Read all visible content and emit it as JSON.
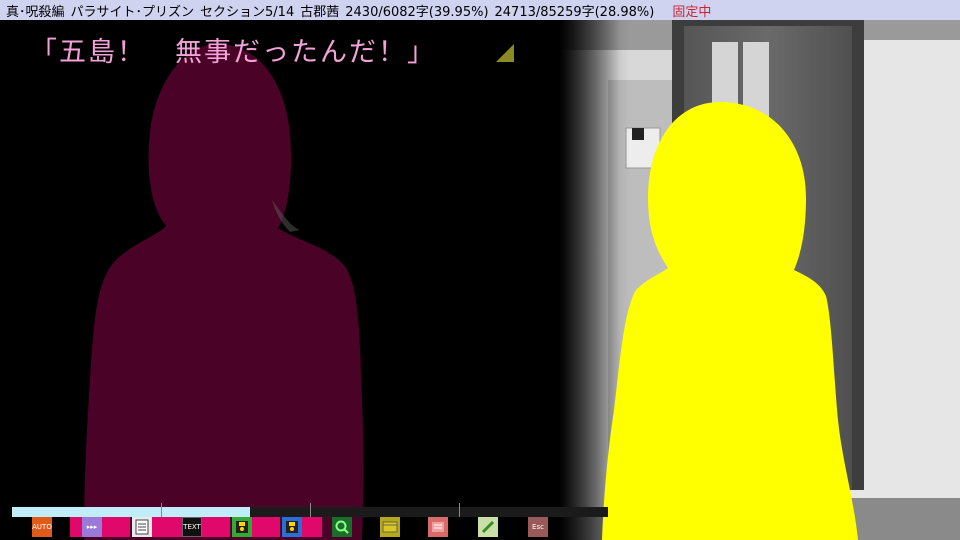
{
  "title_bar": {
    "chapter": "真･呪殺編",
    "location": "パラサイト･プリズン",
    "section": "セクション5/14",
    "character": "古郡茜",
    "section_progress": "2430/6082字(39.95%)",
    "total_progress": "24713/85259字(28.98%)",
    "fixed_status": "固定中"
  },
  "dialogue": {
    "text": "「五島！　無事だったんだ！」"
  },
  "progress": {
    "fraction": 0.3995
  },
  "toolbar": {
    "auto_label": "AUTO",
    "skip_label": "▸▸▸",
    "text_label": "TEXT",
    "esc_label": "Esc"
  },
  "colors": {
    "title_bg": "#cfd3f0",
    "dialogue_text": "#f2a2d8",
    "left_silhouette": "#4a0326",
    "right_silhouette": "#ffff00",
    "toolbar_segment": "#e0086a",
    "progress_fill": "#bfeef8"
  },
  "icons": [
    "auto-icon",
    "skip-icon",
    "log-icon",
    "text-icon",
    "save-icon",
    "load-icon",
    "search-icon",
    "window-icon",
    "config-icon",
    "edit-icon",
    "exit-icon"
  ]
}
